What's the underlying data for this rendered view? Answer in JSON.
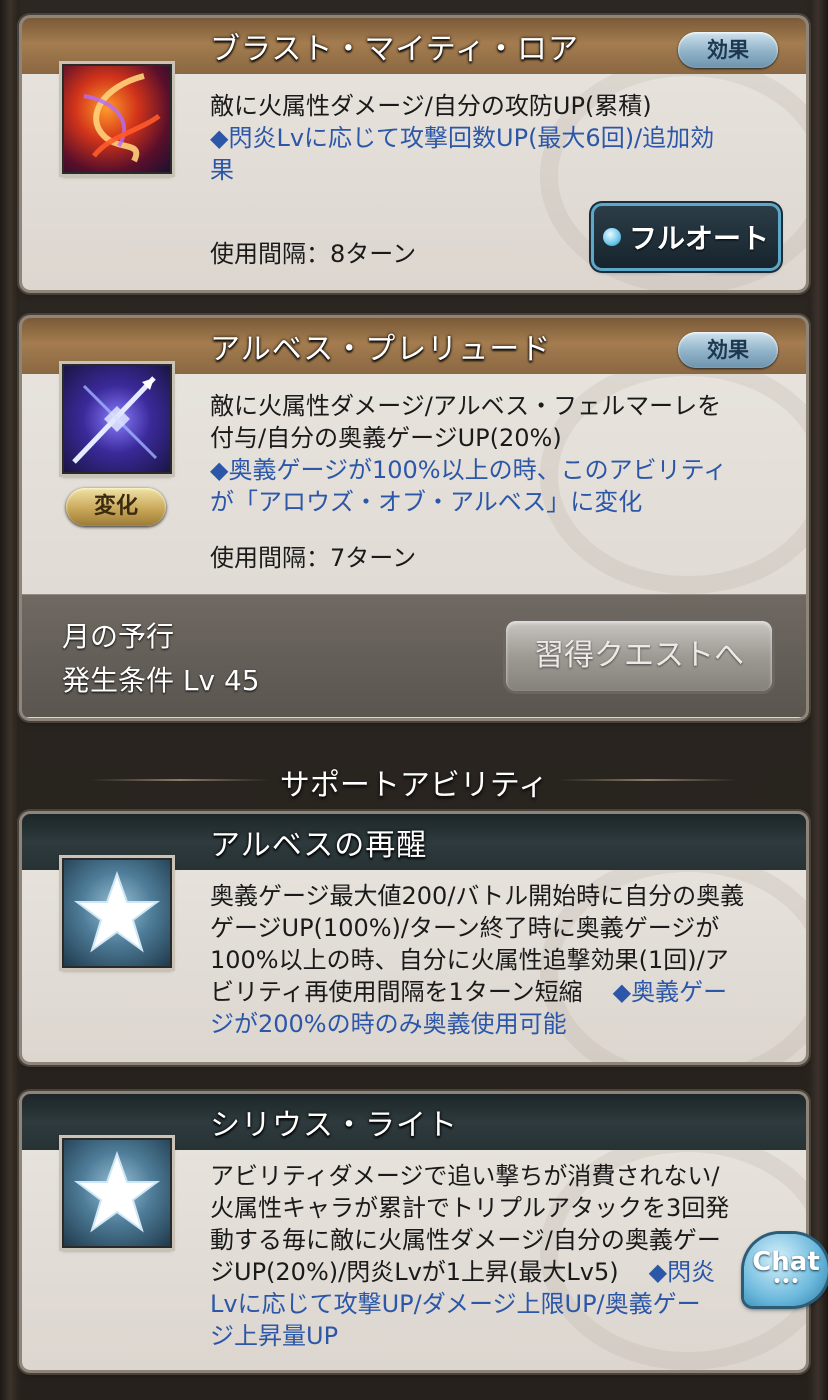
{
  "abilities": [
    {
      "name": "ブラスト・マイティ・ロア",
      "effect_label": "効果",
      "icon": "fire-swirl-icon",
      "desc_lines": [
        "敵に火属性ダメージ/自分の攻防UP(累積)"
      ],
      "blue_lines": [
        "◆閃炎Lvに応じて攻撃回数UP(最大6回)/追加効",
        "果"
      ],
      "interval": "使用間隔：8ターン",
      "button_label": "フルオート"
    },
    {
      "name": "アルベス・プレリュード",
      "effect_label": "効果",
      "icon": "arrow-icon",
      "badge": "変化",
      "desc_lines": [
        "敵に火属性ダメージ/アルベス・フェルマーレを",
        "付与/自分の奥義ゲージUP(20%)"
      ],
      "blue_lines": [
        "◆奥義ゲージが100%以上の時、このアビリティ",
        "が「アロウズ・オブ・アルベス」に変化"
      ],
      "interval": "使用間隔：7ターン",
      "quest_name": "月の予行",
      "quest_condition": "発生条件 Lv 45",
      "quest_button": "習得クエストへ"
    }
  ],
  "section_title": "サポートアビリティ",
  "support": [
    {
      "name": "アルベスの再醒",
      "icon": "star-icon",
      "lines": [
        "奥義ゲージ最大値200/バトル開始時に自分の奥義",
        "ゲージUP(100%)/ターン終了時に奥義ゲージが",
        "100%以上の時、自分に火属性追撃効果(1回)/ア",
        "ビリティ再使用間隔を1ターン短縮"
      ],
      "blue_tail": "◆奥義ゲー",
      "blue_last": "ジが200%の時のみ奥義使用可能"
    },
    {
      "name": "シリウス・ライト",
      "icon": "star-icon",
      "lines": [
        "アビリティダメージで追い撃ちが消費されない/",
        "火属性キャラが累計でトリプルアタックを3回発",
        "動する毎に敵に火属性ダメージ/自分の奥義ゲー",
        "ジUP(20%)/閃炎Lvが1上昇(最大Lv5)"
      ],
      "blue_tail": "◆閃炎",
      "blue_last_lines": [
        "Lvに応じて攻撃UP/ダメージ上限UP/奥義ゲー",
        "ジ上昇量UP"
      ]
    }
  ],
  "chat_label": "Chat",
  "chat_dots": "•••"
}
